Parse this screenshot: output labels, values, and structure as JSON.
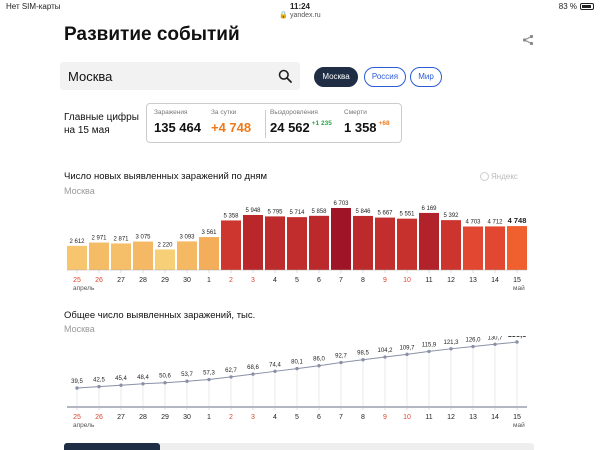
{
  "status_bar": {
    "carrier": "Нет SIM-карты",
    "time": "11:24",
    "battery": "83 %",
    "battery_level": 0.83,
    "url": "yandex.ru"
  },
  "page": {
    "title": "Развитие событий"
  },
  "search": {
    "value": "Москва",
    "icon": "search-icon"
  },
  "region_tabs": [
    {
      "label": "Москва",
      "active": true
    },
    {
      "label": "Россия",
      "active": false
    },
    {
      "label": "Мир",
      "active": false
    }
  ],
  "main_figures": {
    "label_line1": "Главные цифры",
    "label_line2": "на 15 мая",
    "infected": {
      "label": "Заражения",
      "value": "135 464"
    },
    "per_day": {
      "label": "За сутки",
      "value": "+4 748"
    },
    "recovered": {
      "label": "Выздоровления",
      "value": "24 562",
      "delta": "+1 235"
    },
    "deaths": {
      "label": "Смерти",
      "value": "1 358",
      "delta": "+68"
    }
  },
  "watermark": "Яндекс",
  "colors": {
    "accent": "#2b5bd7",
    "active_tab": "#1f2d45",
    "weekend_red": "#e0462b",
    "orange": "#f07a1a",
    "green": "#2aa84a"
  },
  "month_labels": [
    {
      "index": 0,
      "label": "апрель"
    },
    {
      "index": 20,
      "label": "май"
    }
  ],
  "chart_data": [
    {
      "type": "bar",
      "title": "Число новых выявленных заражений по дням",
      "region": "Москва",
      "categories": [
        "25",
        "26",
        "27",
        "28",
        "29",
        "30",
        "1",
        "2",
        "3",
        "4",
        "5",
        "6",
        "7",
        "8",
        "9",
        "10",
        "11",
        "12",
        "13",
        "14",
        "15"
      ],
      "weekend_indices": [
        0,
        1,
        7,
        8,
        14,
        15
      ],
      "values": [
        2612,
        2971,
        2871,
        3075,
        2220,
        3093,
        3561,
        5358,
        5948,
        5795,
        5714,
        5858,
        6703,
        5846,
        5667,
        5551,
        6169,
        5392,
        4703,
        4712,
        4748
      ],
      "value_labels": [
        "2 612",
        "2 971",
        "2 871",
        "3 075",
        "2 220",
        "3 093",
        "3 561",
        "5 358",
        "5 948",
        "5 795",
        "5 714",
        "5 858",
        "6 703",
        "5 846",
        "5 667",
        "5 551",
        "6 169",
        "5 392",
        "4 703",
        "4 712",
        "4 748"
      ],
      "ylim": [
        0,
        6703
      ],
      "grid": false,
      "legend": "none"
    },
    {
      "type": "line",
      "title": "Общее число выявленных заражений, тыс.",
      "region": "Москва",
      "categories": [
        "25",
        "26",
        "27",
        "28",
        "29",
        "30",
        "1",
        "2",
        "3",
        "4",
        "5",
        "6",
        "7",
        "8",
        "9",
        "10",
        "11",
        "12",
        "13",
        "14",
        "15"
      ],
      "weekend_indices": [
        0,
        1,
        7,
        8,
        14,
        15
      ],
      "values": [
        39.5,
        42.5,
        45.4,
        48.4,
        50.6,
        53.7,
        57.3,
        62.7,
        68.6,
        74.4,
        80.1,
        86.0,
        92.7,
        98.5,
        104.2,
        109.7,
        115.9,
        121.3,
        126.0,
        130.7,
        135.5
      ],
      "value_labels": [
        "39,5",
        "42,5",
        "45,4",
        "48,4",
        "50,6",
        "53,7",
        "57,3",
        "62,7",
        "68,6",
        "74,4",
        "80,1",
        "86,0",
        "92,7",
        "98,5",
        "104,2",
        "109,7",
        "115,9",
        "121,3",
        "126,0",
        "130,7",
        "135,5"
      ],
      "ylim": [
        0,
        135.5
      ],
      "grid": true,
      "legend": "none"
    }
  ]
}
